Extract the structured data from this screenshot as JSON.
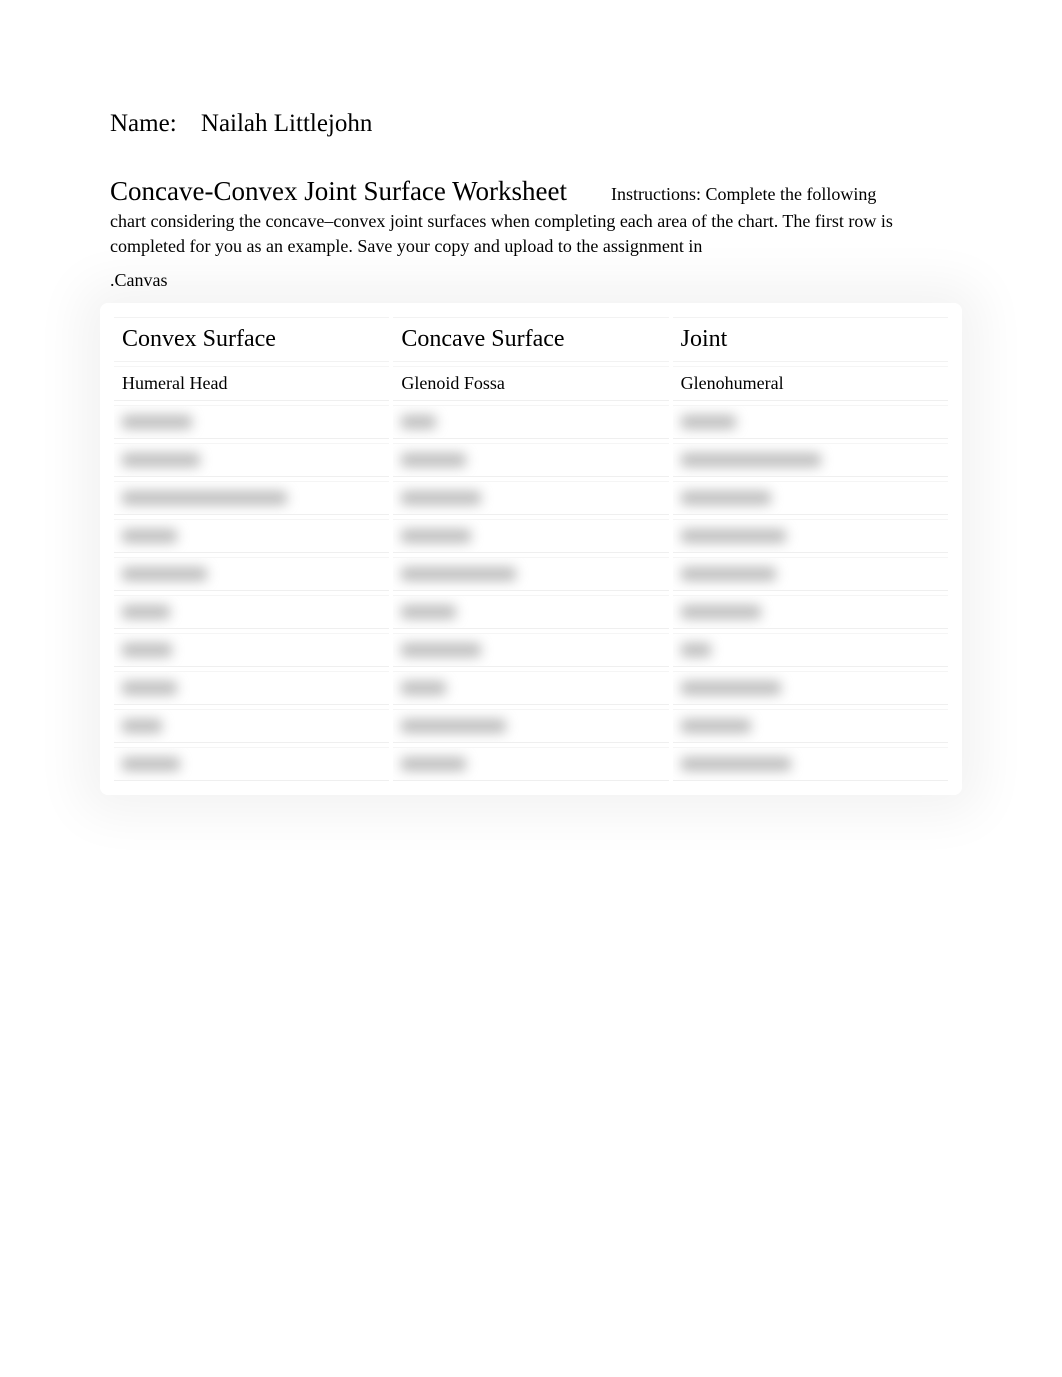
{
  "header": {
    "name_label": "Name:",
    "name_value": "Nailah Littlejohn"
  },
  "title": "Concave-Convex Joint Surface Worksheet",
  "instructions_inline": "Instructions: Complete the following",
  "instructions_body": "chart considering the concave–convex joint surfaces when completing each area of the chart. The first row is completed for you as an example. Save your copy and upload to the assignment in",
  "canvas_line": ".Canvas",
  "table": {
    "headers": {
      "convex": "Convex Surface",
      "concave": "Concave Surface",
      "joint": "Joint"
    },
    "rows": [
      {
        "convex": "Humeral Head",
        "concave": "Glenoid Fossa",
        "joint": "Glenohumeral",
        "visible": true
      },
      {
        "convex": "",
        "concave": "",
        "joint": "",
        "visible": false,
        "widths": [
          70,
          35,
          55
        ]
      },
      {
        "convex": "",
        "concave": "",
        "joint": "",
        "visible": false,
        "widths": [
          78,
          65,
          140
        ]
      },
      {
        "convex": "",
        "concave": "",
        "joint": "",
        "visible": false,
        "widths": [
          165,
          80,
          90
        ]
      },
      {
        "convex": "",
        "concave": "",
        "joint": "",
        "visible": false,
        "widths": [
          55,
          70,
          105
        ]
      },
      {
        "convex": "",
        "concave": "",
        "joint": "",
        "visible": false,
        "widths": [
          85,
          115,
          95
        ]
      },
      {
        "convex": "",
        "concave": "",
        "joint": "",
        "visible": false,
        "widths": [
          48,
          55,
          80
        ]
      },
      {
        "convex": "",
        "concave": "",
        "joint": "",
        "visible": false,
        "widths": [
          50,
          80,
          30
        ]
      },
      {
        "convex": "",
        "concave": "",
        "joint": "",
        "visible": false,
        "widths": [
          55,
          45,
          100
        ]
      },
      {
        "convex": "",
        "concave": "",
        "joint": "",
        "visible": false,
        "widths": [
          40,
          105,
          70
        ]
      },
      {
        "convex": "",
        "concave": "",
        "joint": "",
        "visible": false,
        "widths": [
          58,
          65,
          110
        ]
      }
    ]
  }
}
